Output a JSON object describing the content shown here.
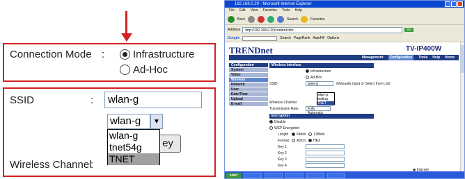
{
  "zoom": {
    "connection_mode_label": "Connection Mode",
    "colon": ":",
    "options": [
      {
        "label": "Infrastructure",
        "selected": true
      },
      {
        "label": "Ad-Hoc",
        "selected": false
      }
    ],
    "ssid_label": "SSID",
    "ssid_value": "wlan-g",
    "dropdown_value": "wlan-g",
    "dropdown_options": [
      "wlan-g",
      "tnet54g",
      "TNET"
    ],
    "dropdown_highlighted": "TNET",
    "hidden_button_label": "ey",
    "wireless_channel_label": "Wireless Channel",
    "arrow_color": "#d42020"
  },
  "ie": {
    "title": "192.168.0.20 - Microsoft Internet Explorer",
    "menu": [
      "File",
      "Edit",
      "View",
      "Favorites",
      "Tools",
      "Help"
    ],
    "toolbar": [
      "Back",
      "Search",
      "Favorites"
    ],
    "address_label": "Address",
    "address_value": "http://192.168.0.20/content.htm",
    "go_label": "Go",
    "google_label": "Google",
    "google_items": [
      "Search",
      "PageRank",
      "AutoFill",
      "Options"
    ],
    "status_text": "Internet",
    "start_label": "start",
    "tasks": [
      "",
      "",
      "",
      "",
      ""
    ]
  },
  "trendnet": {
    "logo": "TRENDnet",
    "model": "TV-IP400W",
    "nav": [
      "Management",
      "Configuration",
      "Tools",
      "Help",
      "Home"
    ],
    "nav_active": "Configuration",
    "sidebar_header": "Configuration",
    "sidebar": [
      "System",
      "Video",
      "Wireless",
      "Network",
      "User",
      "Date/Time",
      "Upload",
      "E-mail"
    ],
    "sidebar_active": "Wireless",
    "section_wireless": "Wireless Interface",
    "opt_infra": "Infrastructure",
    "opt_adhoc": "Ad-Hoc",
    "ssid_label": "SSID",
    "ssid_value": "wlan-g",
    "ssid_hint": "(Manually Input or Select from List)",
    "dd_options": [
      "wlan-g",
      "testing",
      "TNET"
    ],
    "channel_label": "Wireless Channel",
    "tx_label": "Transmission Rate",
    "tx_value": "Fully Automatic",
    "section_encryption": "Encryption",
    "enc_disable": "Disable",
    "enc_wep": "WEP Encryption",
    "length_label": "Length",
    "length_64": "64bits",
    "length_128": "128bits",
    "format_label": "Format",
    "format_ascii": "ASCII",
    "format_hex": "HEX",
    "keys": [
      "Key 1",
      "Key 2",
      "Key 3",
      "Key 4"
    ]
  }
}
